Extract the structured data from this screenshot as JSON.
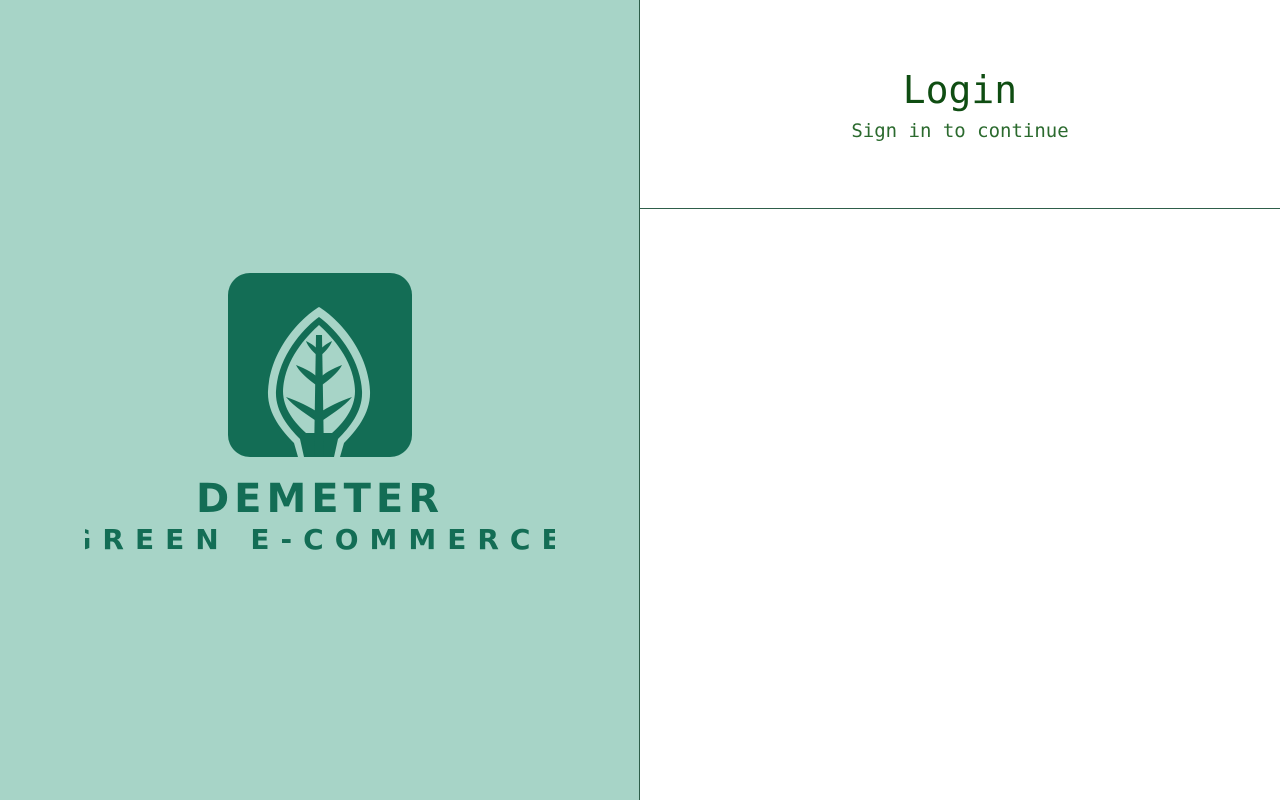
{
  "brand": {
    "logo_name": "DEMETER",
    "logo_tagline": "GREEN E-COMMERCE",
    "logo_icon": "leaf-icon",
    "colors": {
      "panel_background": "#a7d4c7",
      "logo_green": "#136d55"
    }
  },
  "login": {
    "title": "Login",
    "subtitle": "Sign in to continue",
    "colors": {
      "title": "#0f4d12",
      "subtitle": "#2b6a2e",
      "divider": "#2e5e4a"
    }
  }
}
